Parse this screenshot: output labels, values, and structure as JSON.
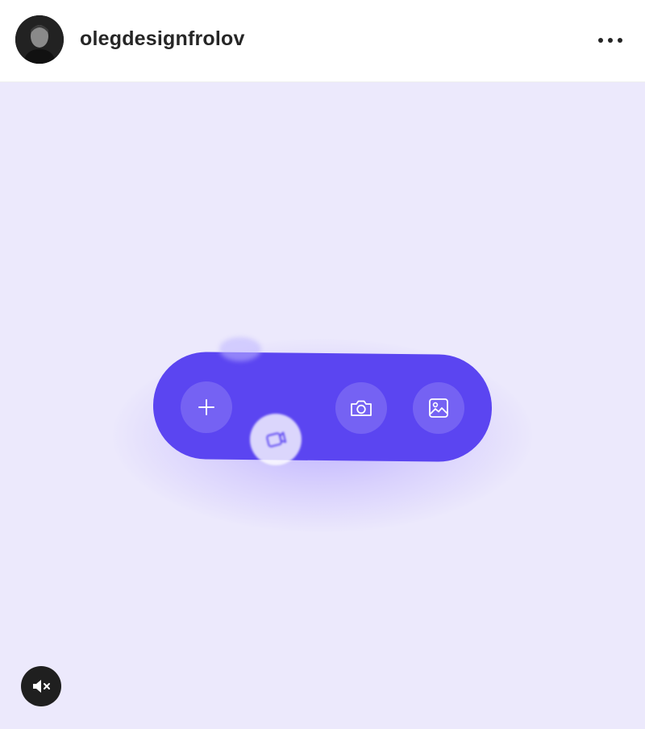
{
  "header": {
    "username": "olegdesignfrolov"
  },
  "icons": {
    "avatar": "profile-photo",
    "more": "more-horizontal-icon",
    "add": "plus-icon",
    "video": "video-clip-icon",
    "camera": "camera-icon",
    "gallery": "image-icon",
    "mute": "speaker-muted-icon"
  },
  "colors": {
    "canvas_background": "#ece9fc",
    "pill_accent": "#5b45f1",
    "header_text": "#262626"
  }
}
